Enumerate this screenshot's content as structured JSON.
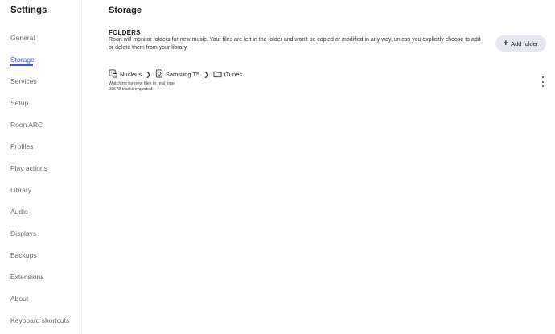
{
  "sidebar": {
    "title": "Settings",
    "items": [
      {
        "label": "General"
      },
      {
        "label": "Storage",
        "active": true
      },
      {
        "label": "Services"
      },
      {
        "label": "Setup"
      },
      {
        "label": "Roon ARC"
      },
      {
        "label": "Profiles"
      },
      {
        "label": "Play actions"
      },
      {
        "label": "Library"
      },
      {
        "label": "Audio"
      },
      {
        "label": "Displays"
      },
      {
        "label": "Backups"
      },
      {
        "label": "Extensions"
      },
      {
        "label": "About"
      },
      {
        "label": "Keyboard shortcuts"
      }
    ]
  },
  "main": {
    "title": "Storage",
    "folders": {
      "heading": "FOLDERS",
      "description": "Roon will monitor folders for new music. Your files are left in the folder and won't be copied or modified in any way, unless you explicitly choose to add or delete them from your library.",
      "add_button_label": "Add folder"
    },
    "folder_entry": {
      "path": [
        {
          "label": "Nucleus",
          "icon": "network-device-icon"
        },
        {
          "label": "Samsung T5",
          "icon": "drive-icon"
        },
        {
          "label": "iTunes",
          "icon": "folder-icon"
        }
      ],
      "status": "Watching for new files in real time",
      "tracks": "27578 tracks imported"
    }
  },
  "colors": {
    "accent": "#3a55e6",
    "button_bg": "#e6e8ef"
  }
}
